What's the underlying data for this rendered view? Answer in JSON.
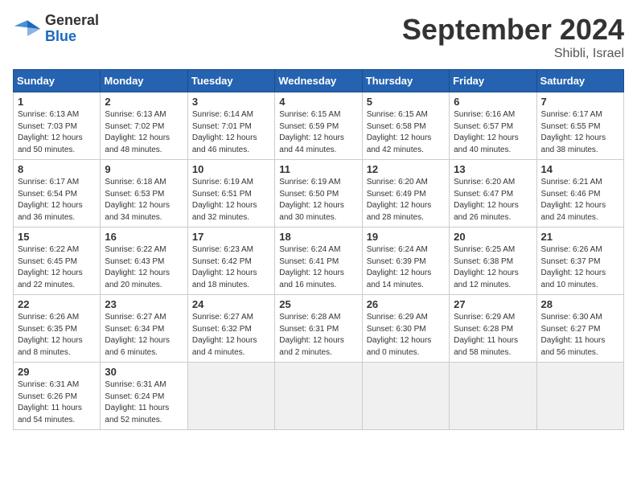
{
  "logo": {
    "line1": "General",
    "line2": "Blue"
  },
  "title": "September 2024",
  "location": "Shibli, Israel",
  "weekdays": [
    "Sunday",
    "Monday",
    "Tuesday",
    "Wednesday",
    "Thursday",
    "Friday",
    "Saturday"
  ],
  "weeks": [
    [
      {
        "day": "1",
        "rise": "6:13 AM",
        "set": "7:03 PM",
        "daylight": "12 hours and 50 minutes."
      },
      {
        "day": "2",
        "rise": "6:13 AM",
        "set": "7:02 PM",
        "daylight": "12 hours and 48 minutes."
      },
      {
        "day": "3",
        "rise": "6:14 AM",
        "set": "7:01 PM",
        "daylight": "12 hours and 46 minutes."
      },
      {
        "day": "4",
        "rise": "6:15 AM",
        "set": "6:59 PM",
        "daylight": "12 hours and 44 minutes."
      },
      {
        "day": "5",
        "rise": "6:15 AM",
        "set": "6:58 PM",
        "daylight": "12 hours and 42 minutes."
      },
      {
        "day": "6",
        "rise": "6:16 AM",
        "set": "6:57 PM",
        "daylight": "12 hours and 40 minutes."
      },
      {
        "day": "7",
        "rise": "6:17 AM",
        "set": "6:55 PM",
        "daylight": "12 hours and 38 minutes."
      }
    ],
    [
      {
        "day": "8",
        "rise": "6:17 AM",
        "set": "6:54 PM",
        "daylight": "12 hours and 36 minutes."
      },
      {
        "day": "9",
        "rise": "6:18 AM",
        "set": "6:53 PM",
        "daylight": "12 hours and 34 minutes."
      },
      {
        "day": "10",
        "rise": "6:19 AM",
        "set": "6:51 PM",
        "daylight": "12 hours and 32 minutes."
      },
      {
        "day": "11",
        "rise": "6:19 AM",
        "set": "6:50 PM",
        "daylight": "12 hours and 30 minutes."
      },
      {
        "day": "12",
        "rise": "6:20 AM",
        "set": "6:49 PM",
        "daylight": "12 hours and 28 minutes."
      },
      {
        "day": "13",
        "rise": "6:20 AM",
        "set": "6:47 PM",
        "daylight": "12 hours and 26 minutes."
      },
      {
        "day": "14",
        "rise": "6:21 AM",
        "set": "6:46 PM",
        "daylight": "12 hours and 24 minutes."
      }
    ],
    [
      {
        "day": "15",
        "rise": "6:22 AM",
        "set": "6:45 PM",
        "daylight": "12 hours and 22 minutes."
      },
      {
        "day": "16",
        "rise": "6:22 AM",
        "set": "6:43 PM",
        "daylight": "12 hours and 20 minutes."
      },
      {
        "day": "17",
        "rise": "6:23 AM",
        "set": "6:42 PM",
        "daylight": "12 hours and 18 minutes."
      },
      {
        "day": "18",
        "rise": "6:24 AM",
        "set": "6:41 PM",
        "daylight": "12 hours and 16 minutes."
      },
      {
        "day": "19",
        "rise": "6:24 AM",
        "set": "6:39 PM",
        "daylight": "12 hours and 14 minutes."
      },
      {
        "day": "20",
        "rise": "6:25 AM",
        "set": "6:38 PM",
        "daylight": "12 hours and 12 minutes."
      },
      {
        "day": "21",
        "rise": "6:26 AM",
        "set": "6:37 PM",
        "daylight": "12 hours and 10 minutes."
      }
    ],
    [
      {
        "day": "22",
        "rise": "6:26 AM",
        "set": "6:35 PM",
        "daylight": "12 hours and 8 minutes."
      },
      {
        "day": "23",
        "rise": "6:27 AM",
        "set": "6:34 PM",
        "daylight": "12 hours and 6 minutes."
      },
      {
        "day": "24",
        "rise": "6:27 AM",
        "set": "6:32 PM",
        "daylight": "12 hours and 4 minutes."
      },
      {
        "day": "25",
        "rise": "6:28 AM",
        "set": "6:31 PM",
        "daylight": "12 hours and 2 minutes."
      },
      {
        "day": "26",
        "rise": "6:29 AM",
        "set": "6:30 PM",
        "daylight": "12 hours and 0 minutes."
      },
      {
        "day": "27",
        "rise": "6:29 AM",
        "set": "6:28 PM",
        "daylight": "11 hours and 58 minutes."
      },
      {
        "day": "28",
        "rise": "6:30 AM",
        "set": "6:27 PM",
        "daylight": "11 hours and 56 minutes."
      }
    ],
    [
      {
        "day": "29",
        "rise": "6:31 AM",
        "set": "6:26 PM",
        "daylight": "11 hours and 54 minutes."
      },
      {
        "day": "30",
        "rise": "6:31 AM",
        "set": "6:24 PM",
        "daylight": "11 hours and 52 minutes."
      },
      null,
      null,
      null,
      null,
      null
    ]
  ],
  "labels": {
    "sunrise": "Sunrise:",
    "sunset": "Sunset:",
    "daylight": "Daylight:"
  }
}
